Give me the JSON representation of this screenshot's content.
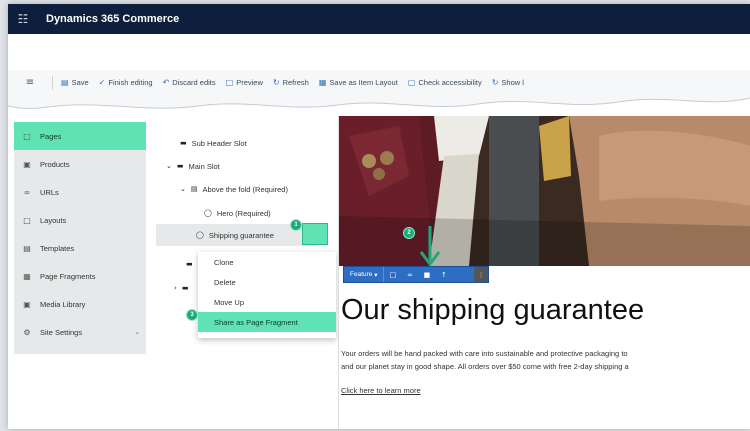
{
  "app": {
    "title": "Dynamics 365 Commerce",
    "waffle_icon": "waffle-icon"
  },
  "toolbar": {
    "items": [
      {
        "label": "Save",
        "icon": "save-icon"
      },
      {
        "label": "Finish editing",
        "icon": "checkmark-icon"
      },
      {
        "label": "Discard edits",
        "icon": "undo-icon"
      },
      {
        "label": "Preview",
        "icon": "preview-icon"
      },
      {
        "label": "Refresh",
        "icon": "refresh-icon"
      },
      {
        "label": "Save as Item Layout",
        "icon": "layout-icon"
      },
      {
        "label": "Check accessibility",
        "icon": "accessibility-icon"
      },
      {
        "label": "Show l",
        "icon": "show-icon"
      }
    ]
  },
  "nav": {
    "items": [
      {
        "label": "Pages",
        "icon": "page-icon",
        "active": true
      },
      {
        "label": "Products",
        "icon": "product-icon"
      },
      {
        "label": "URLs",
        "icon": "link-icon"
      },
      {
        "label": "Layouts",
        "icon": "layout-icon"
      },
      {
        "label": "Templates",
        "icon": "template-icon"
      },
      {
        "label": "Page Fragments",
        "icon": "fragment-icon"
      },
      {
        "label": "Media Library",
        "icon": "media-icon"
      },
      {
        "label": "Site Settings",
        "icon": "gear-icon"
      }
    ]
  },
  "tree": {
    "rows": [
      {
        "label": "Sub Header Slot"
      },
      {
        "label": "Main Slot"
      },
      {
        "label": "Above the fold (Required)"
      },
      {
        "label": "Hero (Required)"
      },
      {
        "label": "Shipping guarantee"
      }
    ]
  },
  "callouts": {
    "one": "1",
    "two": "2",
    "three": "3"
  },
  "context_menu": {
    "items": [
      {
        "label": "Clone"
      },
      {
        "label": "Delete"
      },
      {
        "label": "Move Up"
      },
      {
        "label": "Share as Page Fragment"
      }
    ]
  },
  "edit_bar": {
    "feature_label": "Feature"
  },
  "content": {
    "headline": "Our shipping guarantee",
    "body_line1": "Your orders will be hand packed with care into sustainable and protective packaging to",
    "body_line2": "and our planet stay in good shape.  All orders over $50 come with free 2-day shipping a",
    "link_text": "Click here to learn more"
  },
  "colors": {
    "accent": "#5fe3b4",
    "topbar": "#0d1f3c",
    "edit_bar": "#2d6ec4"
  }
}
